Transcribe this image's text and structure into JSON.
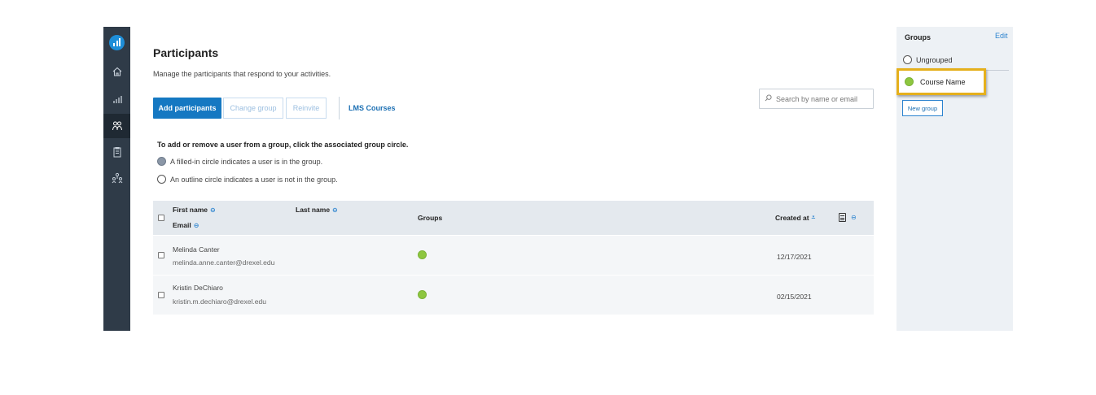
{
  "page": {
    "title": "Participants",
    "subtitle": "Manage the participants that respond to your activities."
  },
  "toolbar": {
    "add_label": "Add participants",
    "change_group_label": "Change group",
    "reinvite_label": "Reinvite",
    "lms_label": "LMS Courses"
  },
  "search": {
    "placeholder": "Search by name or email",
    "icon": "search-icon"
  },
  "hints": {
    "heading": "To add or remove a user from a group, click the associated group circle.",
    "filled": "A filled-in circle indicates a user is in the group.",
    "outline": "An outline circle indicates a user is not in the group."
  },
  "table": {
    "headers": {
      "first_name": "First name",
      "last_name": "Last name",
      "email": "Email",
      "groups": "Groups",
      "created_at": "Created at"
    },
    "rows": [
      {
        "name": "Melinda Canter",
        "email": "melinda.anne.canter@drexel.edu",
        "created": "12/17/2021",
        "in_group": true
      },
      {
        "name": "Kristin DeChiaro",
        "email": "kristin.m.dechiaro@drexel.edu",
        "created": "02/15/2021",
        "in_group": true
      }
    ]
  },
  "groups_panel": {
    "title": "Groups",
    "edit_label": "Edit",
    "items": [
      {
        "label": "Ungrouped",
        "filled": false
      },
      {
        "label": "Course Name",
        "filled": true,
        "highlighted": true
      }
    ],
    "new_group_label": "New group"
  },
  "nav": {
    "items": [
      "logo-icon",
      "home-icon",
      "activities-icon",
      "participants-icon",
      "reports-icon",
      "team-icon"
    ],
    "active": "participants-icon"
  },
  "colors": {
    "nav_bg": "#2f3b48",
    "primary": "#1578c2",
    "group_green": "#8dc63f",
    "highlight": "#e5b01c"
  }
}
